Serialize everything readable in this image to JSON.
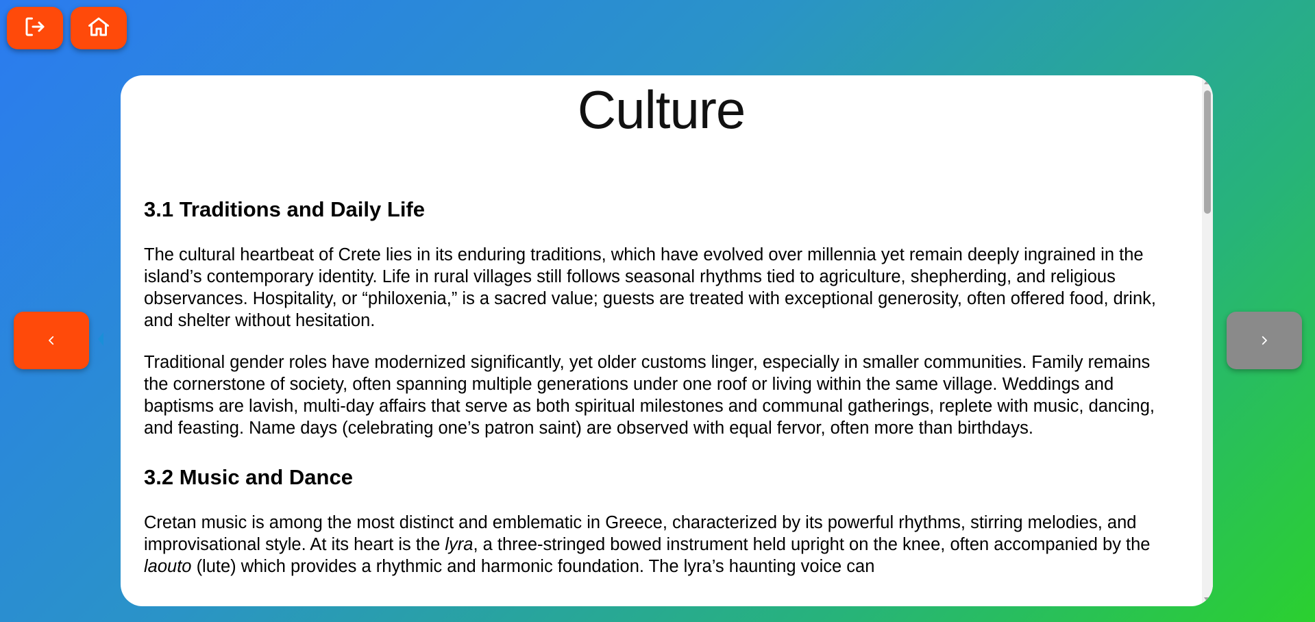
{
  "toolbar": {
    "logout_icon": "logout-icon",
    "home_icon": "home-icon",
    "accent_color": "#ff4a0a"
  },
  "navigation": {
    "prev_icon": "chevron-left-icon",
    "next_icon": "chevron-right-icon",
    "prev_color": "#ff4a0a",
    "next_color": "#8a8a8a"
  },
  "card": {
    "title": "Culture",
    "sections": [
      {
        "heading": "3.1 Traditions and Daily Life",
        "paragraphs": [
          "The cultural heartbeat of Crete lies in its enduring traditions, which have evolved over millennia yet remain deeply ingrained in the island’s contemporary identity. Life in rural villages still follows seasonal rhythms tied to agriculture, shepherding, and religious observances. Hospitality, or “philoxenia,” is a sacred value; guests are treated with exceptional generosity, often offered food, drink, and shelter without hesitation.",
          "Traditional gender roles have modernized significantly, yet older customs linger, especially in smaller communities. Family remains the cornerstone of society, often spanning multiple generations under one roof or living within the same village. Weddings and baptisms are lavish, multi-day affairs that serve as both spiritual milestones and communal gatherings, replete with music, dancing, and feasting. Name days (celebrating one’s patron saint) are observed with equal fervor, often more than birthdays."
        ]
      },
      {
        "heading": "3.2 Music and Dance",
        "paragraph_parts": {
          "p1": "Cretan music is among the most distinct and emblematic in Greece, characterized by its powerful rhythms, stirring melodies, and improvisational style. At its heart is the ",
          "em1": "lyra",
          "p2": ", a three-stringed bowed instrument held upright on the knee, often accompanied by the ",
          "em2": "laouto",
          "p3": " (lute) which provides a rhythmic and harmonic foundation. The lyra’s haunting voice can"
        }
      }
    ]
  }
}
